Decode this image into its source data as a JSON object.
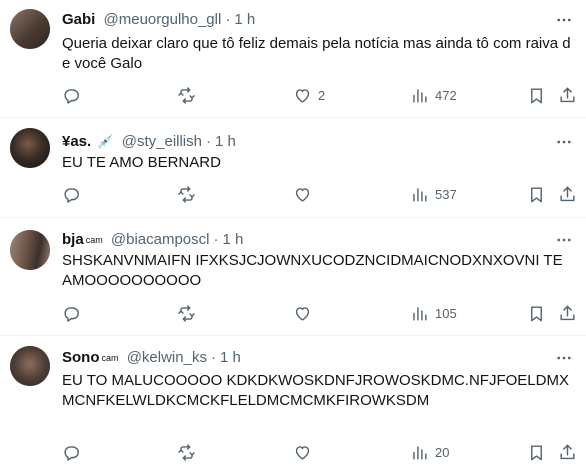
{
  "tweets": [
    {
      "name": "Gabi",
      "name_badge": "",
      "handle": "@meuorgulho_gll",
      "time": "1 h",
      "text": "Queria deixar claro que tô feliz demais pela notícia mas ainda tô com raiva de você Galo",
      "likes": "2",
      "views": "472",
      "avatar_color": "#5a4a3f"
    },
    {
      "name": "¥as.",
      "name_badge": "💉",
      "handle": "@sty_eillish",
      "time": "1 h",
      "text": "EU TE AMO BERNARD",
      "likes": "",
      "views": "537",
      "avatar_color": "#2f2a27"
    },
    {
      "name": "bja",
      "name_badge": "cam",
      "handle": "@biacamposcl",
      "time": "1 h",
      "text": "SHSKANVNMAIFN IFXKSJCJOWNXUCODZNCIDMAICNODXNXOVNI TE AMOOOOOOOOOO",
      "likes": "",
      "views": "105",
      "avatar_color": "#6b5648"
    },
    {
      "name": "Sono",
      "name_badge": "cam",
      "handle": "@kelwin_ks",
      "time": "1 h",
      "text": "EU TO MALUCOOOOO KDKDKWOSKDNFJROWOSKDMC.NFJFOELDMXMCNFKELWLDKCMCKFLELDMCMCMKFIROWKSDM",
      "likes": "",
      "views": "20",
      "avatar_color": "#4a3d36"
    }
  ],
  "separator": "·"
}
